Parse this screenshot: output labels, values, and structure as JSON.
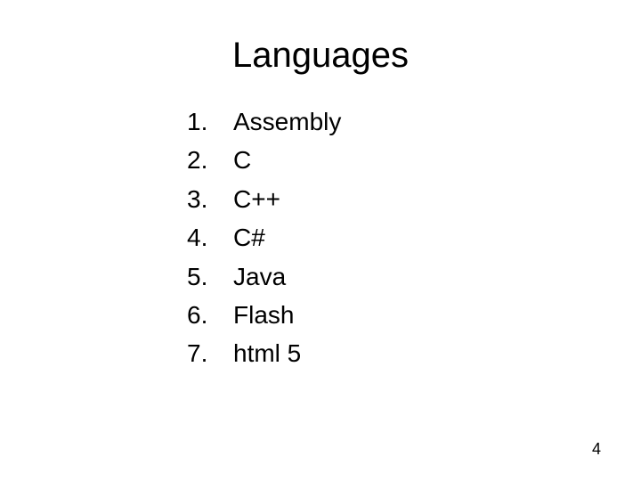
{
  "title": "Languages",
  "items": [
    {
      "num": "1.",
      "label": "Assembly"
    },
    {
      "num": "2.",
      "label": "C"
    },
    {
      "num": "3.",
      "label": "C++"
    },
    {
      "num": "4.",
      "label": "C#"
    },
    {
      "num": "5.",
      "label": "Java"
    },
    {
      "num": "6.",
      "label": "Flash"
    },
    {
      "num": "7.",
      "label": "html 5"
    }
  ],
  "page_number": "4"
}
